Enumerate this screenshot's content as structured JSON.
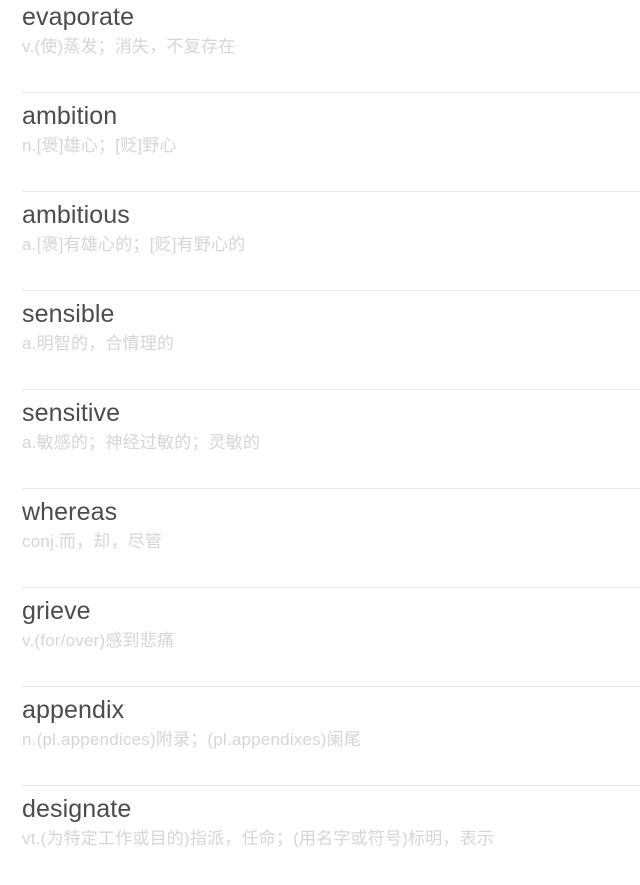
{
  "list": {
    "entries": [
      {
        "headword": "evaporate",
        "definition": "v.(使)蒸发；消失，不复存在"
      },
      {
        "headword": "ambition",
        "definition": "n.[褒]雄心；[贬]野心"
      },
      {
        "headword": "ambitious",
        "definition": "a.[褒]有雄心的；[贬]有野心的"
      },
      {
        "headword": "sensible",
        "definition": "a.明智的，合情理的"
      },
      {
        "headword": "sensitive",
        "definition": "a.敏感的；神经过敏的；灵敏的"
      },
      {
        "headword": "whereas",
        "definition": "conj.而，却，尽管"
      },
      {
        "headword": "grieve",
        "definition": "v.(for/over)感到悲痛"
      },
      {
        "headword": "appendix",
        "definition": "n.(pl.appendices)附录；(pl.appendixes)阑尾"
      },
      {
        "headword": "designate",
        "definition": "vt.(为特定工作或目的)指派，任命；(用名字或符号)标明，表示"
      }
    ]
  },
  "colors": {
    "background": "#ffffff",
    "headword": "#4c4c4c",
    "definition": "#d6d6d6",
    "divider": "#e9e9e9"
  }
}
